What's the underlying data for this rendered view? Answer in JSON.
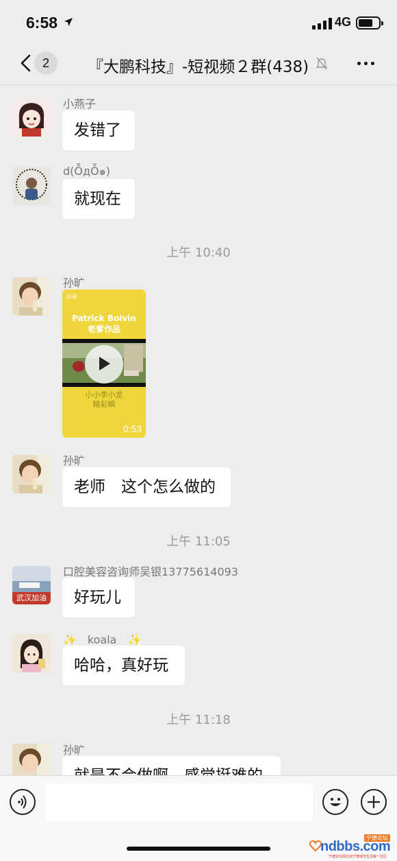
{
  "status_bar": {
    "time": "6:58",
    "network": "4G"
  },
  "nav": {
    "unread_count": "2",
    "title": "『大鹏科技』-短视频２群(438)"
  },
  "messages": [
    {
      "sender": "小燕子",
      "text": "发错了"
    },
    {
      "sender": "d(ỖдỖ๑)",
      "text": "就现在"
    },
    {
      "divider": "上午 10:40"
    },
    {
      "sender": "孙旷",
      "video": {
        "app_logo": "抖音",
        "title_line1": "Patrick Boivin",
        "title_line2": "老爹作品",
        "caption_line1": "小小李小龙",
        "caption_line2": "精彩瞬",
        "duration": "0:53"
      }
    },
    {
      "sender": "孙旷",
      "text": "老师　这个怎么做的"
    },
    {
      "divider": "上午 11:05"
    },
    {
      "sender": "口腔美容咨询师吴银13775614093",
      "avatar_label": "武汉加油",
      "text": "好玩儿"
    },
    {
      "sender": "✨　koala　✨",
      "text": "哈哈，真好玩"
    },
    {
      "divider": "上午 11:18"
    },
    {
      "sender": "孙旷",
      "text": "就是不会做啊，感觉挺难的"
    }
  ],
  "input": {
    "value": ""
  },
  "watermark": {
    "brand": "ndbbs.com",
    "tag": "宁德论坛",
    "sub": "宁德论坛网打造宁德城市生活第一社区"
  },
  "colors": {
    "background": "#ededed",
    "bubble": "#ffffff",
    "divider_text": "#9a9a9a",
    "video_yellow": "#efd63c"
  },
  "icons": {
    "back": "chevron-left-icon",
    "mute": "bell-slash-icon",
    "more": "ellipsis-icon",
    "voice": "voice-icon",
    "emoji": "smiley-icon",
    "plus": "plus-icon",
    "play": "play-icon"
  }
}
